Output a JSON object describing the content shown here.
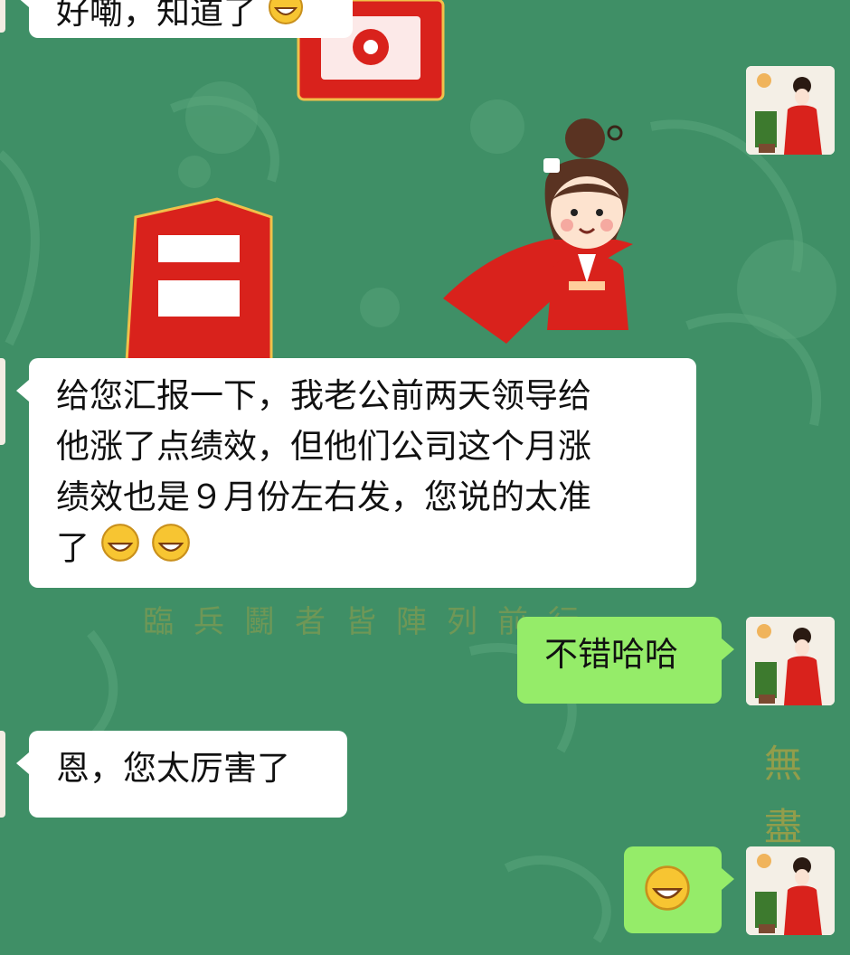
{
  "messages": [
    {
      "side": "left",
      "text_a": "好嘞，知道了",
      "emoji": "grinning-face"
    },
    {
      "side": "left",
      "lines": [
        "给您汇报一下，我老公前两天领导给",
        "他涨了点绩效，但他们公司这个月涨",
        "绩效也是９月份左右发，您说的太准",
        "了"
      ],
      "emoji_count": 2
    },
    {
      "side": "right",
      "text": "不错哈哈"
    },
    {
      "side": "left",
      "text": "恩，您太厉害了"
    },
    {
      "side": "right",
      "emoji": "grinning-face"
    }
  ],
  "background": {
    "deco_line": "臨兵鬭者皆陣列前行",
    "deco_side": "無盡"
  },
  "colors": {
    "bg": "#3f8f66",
    "sent": "#95ec69",
    "received": "#ffffff",
    "accent_red": "#d9221c"
  }
}
